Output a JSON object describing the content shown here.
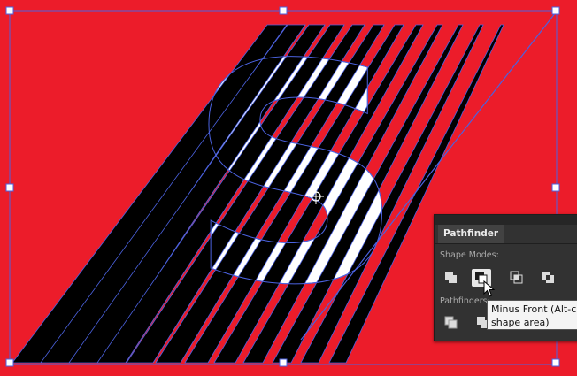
{
  "panel": {
    "title": "Pathfinder",
    "shape_modes_label": "Shape Modes:",
    "pathfinders_label": "Pathfinders:",
    "shape_mode_buttons": [
      "unite-icon",
      "minus-front-icon",
      "intersect-icon",
      "exclude-icon"
    ],
    "pathfinder_buttons": [
      "divide-icon",
      "trim-icon"
    ]
  },
  "tooltip": {
    "line1": "Minus Front (Alt-cl",
    "line2": "shape area)"
  },
  "artwork": {
    "letter": "S",
    "background_color": "#ec1c2a",
    "stripe_color": "#000000",
    "letter_fill": "#ffffff",
    "selection_color": "#4b62e0"
  }
}
